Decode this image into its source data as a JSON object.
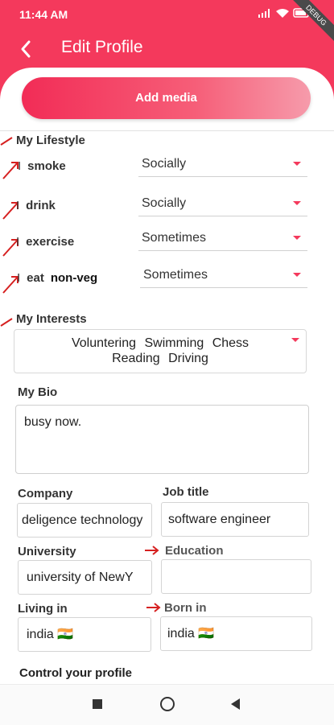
{
  "status_bar": {
    "time": "11:44 AM",
    "icons": "▐▐ ◔ ▮",
    "debug_label": "DEBUG"
  },
  "header": {
    "title": "Edit Profile",
    "add_media_label": "Add media",
    "accent_color": "#f4395c"
  },
  "lifestyle": {
    "title": "My Lifestyle",
    "rows": [
      {
        "prefix": "I",
        "label": "smoke",
        "value": "Socially"
      },
      {
        "prefix": "I",
        "label": "drink",
        "value": "Socially"
      },
      {
        "prefix": "I",
        "label": "exercise",
        "value": "Sometimes"
      },
      {
        "prefix": "I",
        "label": "eat",
        "label_extra": "non-veg",
        "value": "Sometimes"
      }
    ]
  },
  "interests": {
    "title": "My Interests",
    "line1": "Voluntering Swimming Chess",
    "line2": "Reading Driving"
  },
  "bio": {
    "title": "My Bio",
    "value": "busy now."
  },
  "work": {
    "company_label": "Company",
    "company_value": "deligence technology",
    "job_label": "Job title",
    "job_value": "software engineer",
    "university_label": "University",
    "university_value": "university of NewY",
    "education_label": "Education",
    "education_value": "",
    "living_label": "Living in",
    "living_value": "india 🇮🇳",
    "born_label": "Born in",
    "born_value": "india 🇮🇳"
  },
  "control": {
    "title": "Control your profile"
  },
  "annotation_color": "#d62020"
}
